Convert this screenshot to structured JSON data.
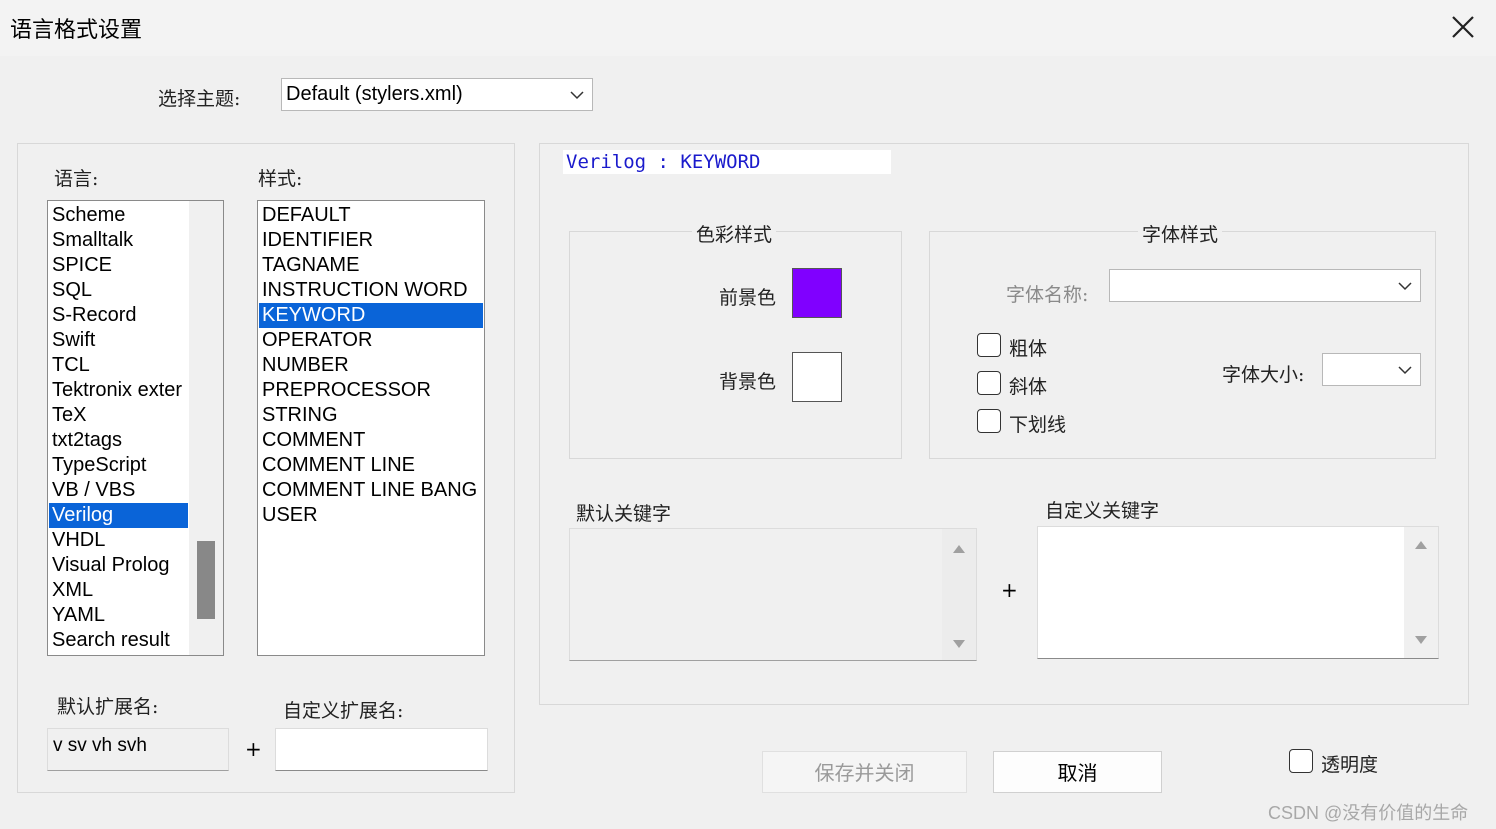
{
  "window": {
    "title": "语言格式设置"
  },
  "theme": {
    "label": "选择主题:",
    "value": "Default (stylers.xml)"
  },
  "language": {
    "label": "语言:",
    "items": [
      "Scheme",
      "Smalltalk",
      "SPICE",
      "SQL",
      "S-Record",
      "Swift",
      "TCL",
      "Tektronix exter",
      "TeX",
      "txt2tags",
      "TypeScript",
      "VB / VBS",
      "Verilog",
      "VHDL",
      "Visual Prolog",
      "XML",
      "YAML",
      "Search result"
    ],
    "selected": "Verilog"
  },
  "style": {
    "label": "样式:",
    "items": [
      "DEFAULT",
      "IDENTIFIER",
      "TAGNAME",
      "INSTRUCTION WORD",
      "KEYWORD",
      "OPERATOR",
      "NUMBER",
      "PREPROCESSOR",
      "STRING",
      "COMMENT",
      "COMMENT LINE",
      "COMMENT LINE BANG",
      "USER"
    ],
    "selected": "KEYWORD"
  },
  "extensions": {
    "default_label": "默认扩展名:",
    "default_value": "v sv vh svh",
    "plus": "+",
    "user_label": "自定义扩展名:",
    "user_value": ""
  },
  "header": {
    "text": "Verilog : KEYWORD",
    "color": "#1a1acc"
  },
  "color_style": {
    "title": "色彩样式",
    "fg_label": "前景色",
    "fg_color": "#8000ff",
    "bg_label": "背景色",
    "bg_color": "#ffffff"
  },
  "font_style": {
    "title": "字体样式",
    "name_label": "字体名称:",
    "name_value": "",
    "size_label": "字体大小:",
    "size_value": "",
    "bold": "粗体",
    "italic": "斜体",
    "underline": "下划线"
  },
  "keywords": {
    "default_label": "默认关键字",
    "plus": "+",
    "user_label": "自定义关键字"
  },
  "buttons": {
    "save_close": "保存并关闭",
    "cancel": "取消"
  },
  "transparency": {
    "label": "透明度"
  },
  "watermark": "CSDN @没有价值的生命"
}
